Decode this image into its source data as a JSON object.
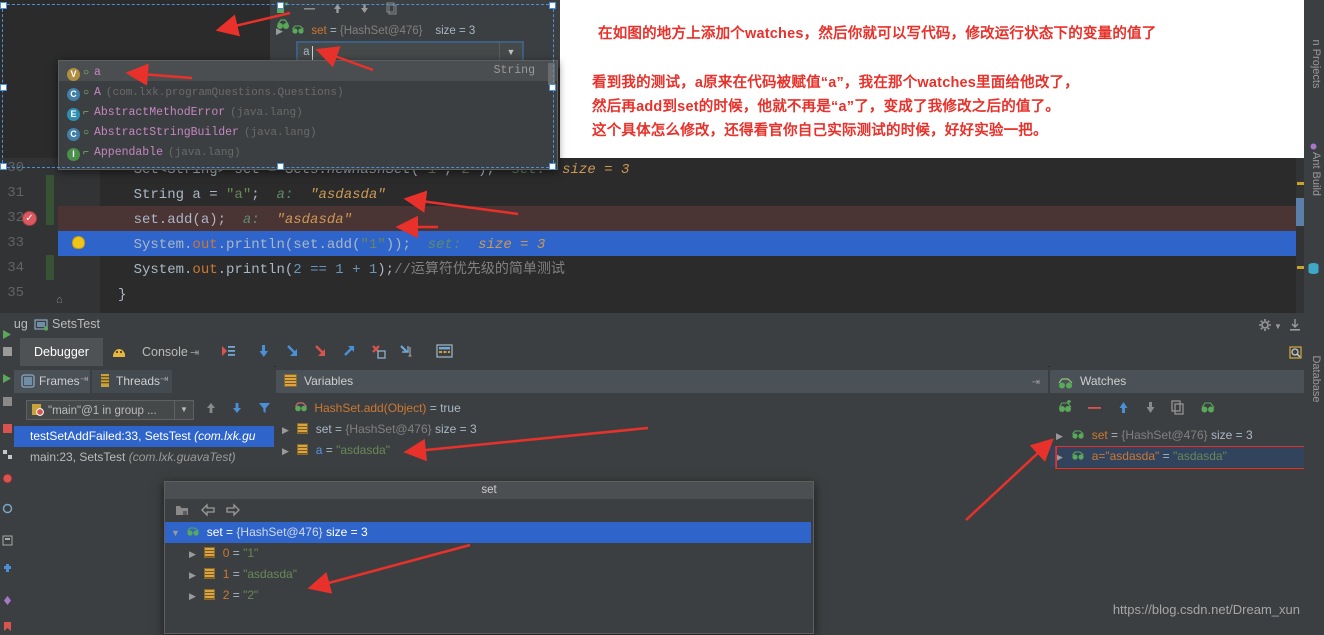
{
  "annotation": {
    "lines": [
      "在如图的地方上添加个watches，然后你就可以写代码，修改运行状态下的变量的值了",
      "看到我的测试，a原来在代码被赋值“a”，我在那个watches里面给他改了，",
      "然后再add到set的时候，他就不再是“a”了，变成了我修改之后的值了。",
      "这个具体怎么修改，还得看官你自己实际测试的时候，好好实验一把。"
    ],
    "color": "#e8312a"
  },
  "editor": {
    "line_numbers": [
      "30",
      "31",
      "32",
      "33",
      "34",
      "35"
    ],
    "lines": [
      {
        "num": "30",
        "segments": [
          {
            "text": "    Set<String> set = Sets.",
            "cls": "plain"
          },
          {
            "text": "newHashSet",
            "cls": "ital"
          },
          {
            "text": "(",
            "cls": "plain"
          },
          {
            "text": "\"1\"",
            "cls": "str"
          },
          {
            "text": ",",
            "cls": "plain"
          },
          {
            "text": "\"2\"",
            "cls": "str"
          },
          {
            "text": ");  ",
            "cls": "plain"
          },
          {
            "text": "set:",
            "cls": "hint"
          },
          {
            "text": "  size = 3",
            "cls": "hintval"
          }
        ]
      },
      {
        "num": "31",
        "segments": [
          {
            "text": "    String a = ",
            "cls": "plain"
          },
          {
            "text": "\"a\"",
            "cls": "str"
          },
          {
            "text": ";  ",
            "cls": "plain"
          },
          {
            "text": "a:",
            "cls": "hint"
          },
          {
            "text": "  \"asdasda\"",
            "cls": "hintval"
          }
        ]
      },
      {
        "num": "32",
        "segments": [
          {
            "text": "    set.add(a);  ",
            "cls": "plain"
          },
          {
            "text": "a:",
            "cls": "hint"
          },
          {
            "text": "  \"asdasda\"",
            "cls": "hintval"
          }
        ]
      },
      {
        "num": "33",
        "segments": [
          {
            "text": "    System.",
            "cls": "plain"
          },
          {
            "text": "out",
            "cls": "kw"
          },
          {
            "text": ".println(set.add(",
            "cls": "plain"
          },
          {
            "text": "\"1\"",
            "cls": "str"
          },
          {
            "text": "));  ",
            "cls": "plain"
          },
          {
            "text": "set:",
            "cls": "hint"
          },
          {
            "text": "  size = 3",
            "cls": "hintval"
          }
        ]
      },
      {
        "num": "34",
        "segments": [
          {
            "text": "    System.",
            "cls": "plain"
          },
          {
            "text": "out",
            "cls": "kw"
          },
          {
            "text": ".println(",
            "cls": "plain"
          },
          {
            "text": "2 == 1 + 1",
            "cls": "num"
          },
          {
            "text": ");",
            "cls": "plain"
          },
          {
            "text": "//运算符优先级的简单测试",
            "cls": "cmt"
          }
        ]
      },
      {
        "num": "35",
        "segments": [
          {
            "text": "}",
            "cls": "fold"
          }
        ]
      }
    ]
  },
  "autocomplete": {
    "items": [
      {
        "icon": "V",
        "icon_color": "#b08d3f",
        "modifier": "○",
        "name": "a",
        "package": "",
        "type": "String",
        "selected": true
      },
      {
        "icon": "C",
        "icon_color": "#3f7fa8",
        "modifier": "○",
        "name": "A",
        "package": "(com.lxk.programQuestions.Questions)",
        "type": "",
        "selected": false
      },
      {
        "icon": "E",
        "icon_color": "#2e8fb5",
        "modifier": "⌐",
        "name": "AbstractMethodError",
        "package": "(java.lang)",
        "type": "",
        "selected": false
      },
      {
        "icon": "C",
        "icon_color": "#3f7fa8",
        "modifier": "○",
        "name": "AbstractStringBuilder",
        "package": "(java.lang)",
        "type": "",
        "selected": false
      },
      {
        "icon": "I",
        "icon_color": "#4a8f4a",
        "modifier": "⌐",
        "name": "Appendable",
        "package": "(java.lang)",
        "type": "",
        "selected": false
      }
    ]
  },
  "watch_popup": {
    "toolbar_icons": [
      "add-watch-icon",
      "remove-watch-icon",
      "move-up-icon",
      "move-down-icon",
      "copy-icon",
      "edit-watch-icon"
    ],
    "row": {
      "name": "set",
      "value": "{HashSet@476}",
      "size": "size = 3"
    },
    "input_value": "a",
    "dropdown_icon": "▼"
  },
  "debug_titlebar": {
    "label": "ebug",
    "config_name": "SetsTest",
    "gear_icon": "gear-icon",
    "collapse_icon": "collapse-icon"
  },
  "debug_tabs": [
    {
      "label": "Debugger",
      "active": true
    },
    {
      "label": "Console",
      "active": false
    }
  ],
  "debug_toolbar_icons": [
    "show-execution-point-icon",
    "step-over-icon",
    "step-into-icon",
    "force-step-into-icon",
    "step-out-icon",
    "drop-frame-icon",
    "run-to-cursor-icon",
    "evaluate-expression-icon"
  ],
  "frames_panel": {
    "tabs": [
      {
        "label": "Frames",
        "icon": "frames-icon"
      },
      {
        "label": "Threads",
        "icon": "threads-icon"
      }
    ],
    "thread_selector": "\"main\"@1 in group ...",
    "toolbar_icons": [
      "sort-up-icon",
      "sort-down-icon",
      "filter-icon"
    ],
    "rows": [
      {
        "text": "testSetAddFailed:33, SetsTest ",
        "italic": "(com.lxk.gu",
        "selected": true
      },
      {
        "text": "main:23, SetsTest ",
        "italic": "(com.lxk.guavaTest)",
        "selected": false
      }
    ]
  },
  "variables_panel": {
    "title": "Variables",
    "icon": "variables-icon",
    "expand_icon": "expand-panel-icon",
    "rows": [
      {
        "arrow": "",
        "icon": "method-result-icon",
        "name": "HashSet.add(Object)",
        "eq": " = ",
        "value": "true",
        "value_type": "bool"
      },
      {
        "arrow": "▶",
        "icon": "field-icon",
        "name": "set",
        "eq": " = ",
        "value": "{HashSet@476}",
        "value_type": "dim",
        "extra": "  size = 3"
      },
      {
        "arrow": "▶",
        "icon": "field-icon",
        "name": "a",
        "eq": " = ",
        "value": "\"asdasda\"",
        "value_type": "str"
      }
    ]
  },
  "watches_panel": {
    "title": "Watches",
    "icon": "watches-icon",
    "expand_icon": "expand-panel-icon",
    "toolbar_icons": [
      "add-watch-icon",
      "remove-watch-icon",
      "move-up-icon",
      "move-down-icon",
      "copy-icon",
      "edit-watch-icon"
    ],
    "rows": [
      {
        "arrow": "▶",
        "name": "set",
        "eq": " = ",
        "value": "{HashSet@476}",
        "extra": "  size = 3",
        "selected": false
      },
      {
        "arrow": "▶",
        "name": "a=\"asdasda\"",
        "eq": " = ",
        "value": "\"asdasda\"",
        "extra": "",
        "selected": true
      }
    ],
    "highlight_color": "#e8312a"
  },
  "set_popup": {
    "title": "set",
    "toolbar_icons": [
      "jump-to-source-icon",
      "back-icon",
      "forward-icon"
    ],
    "rows": [
      {
        "arrow": "▼",
        "icon": "watch-icon",
        "name": "set",
        "eq": " = ",
        "value": "{HashSet@476}",
        "extra": "  size = 3",
        "selected": true,
        "indent": 0
      },
      {
        "arrow": "▶",
        "icon": "field-icon",
        "name": "0",
        "eq": " = ",
        "value": "\"1\"",
        "selected": false,
        "indent": 1
      },
      {
        "arrow": "▶",
        "icon": "field-icon",
        "name": "1",
        "eq": " = ",
        "value": "\"asdasda\"",
        "selected": false,
        "indent": 1
      },
      {
        "arrow": "▶",
        "icon": "field-icon",
        "name": "2",
        "eq": " = ",
        "value": "\"2\"",
        "selected": false,
        "indent": 1
      }
    ]
  },
  "right_rail_tabs": [
    "n Projects",
    "Ant Build",
    "Database"
  ],
  "watermark": "https://blog.csdn.net/Dream_xun",
  "colors": {
    "accent_blue": "#2f65ca",
    "annotation_red": "#e8312a",
    "panel_bg": "#3c3f41",
    "editor_bg": "#2b2b2b",
    "header_bg": "#4a5157"
  }
}
